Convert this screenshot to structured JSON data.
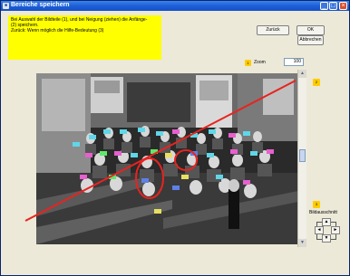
{
  "window": {
    "title": "Bereiche speichern",
    "icon": "app-icon",
    "controls": {
      "minimize": "_",
      "maximize": "□",
      "close": "×"
    }
  },
  "instructions": {
    "lines": [
      "Bei Auswahl der Bildteile (1), und bei Neigung (ziehen) die Anfänge-",
      "(2) speichern.",
      "Zurück: Wenn möglich die Hilfe-Bedeutung (3)"
    ]
  },
  "buttons": {
    "zurueck": "Zurück",
    "ok": "OK",
    "abbrechen": "Abbrechen"
  },
  "zoom": {
    "badge": "1",
    "label": "Zoom",
    "value": "100"
  },
  "badges": {
    "scroll": "2",
    "nav": "3"
  },
  "navigation": {
    "label": "Bildausschnitt",
    "up": "▲",
    "down": "▼",
    "left": "◄",
    "right": "►"
  },
  "scrollbar": {
    "up": "▲",
    "down": "▼",
    "position": 0.45
  },
  "accent_colors": {
    "instruction_bg": "#ffff00",
    "badge": "#ffcc00",
    "annotation_line": "#e8231f",
    "markers_cyan": "#5fd7e8",
    "markers_magenta": "#e85fd0",
    "markers_green": "#5fe86a",
    "markers_yellow": "#e8e05f",
    "markers_blue": "#5f7fe8"
  }
}
